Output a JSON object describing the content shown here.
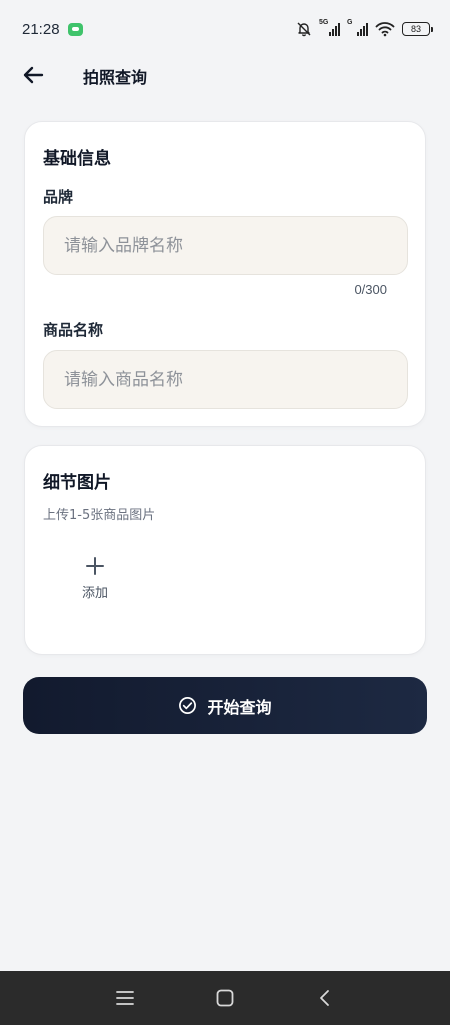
{
  "status_bar": {
    "time": "21:28",
    "sig1_tag": "5G",
    "sig2_tag": "G",
    "battery": "83",
    "icons": [
      "app-notification-icon",
      "bell-muted-icon",
      "signal-icon",
      "wifi-icon",
      "battery-icon"
    ]
  },
  "header": {
    "title": "拍照查询",
    "back_icon": "arrow-left-icon"
  },
  "basic_info": {
    "title": "基础信息",
    "brand": {
      "label": "品牌",
      "value": "",
      "placeholder": "请输入品牌名称",
      "counter": "0/300"
    },
    "product_name": {
      "label": "商品名称",
      "value": "",
      "placeholder": "请输入商品名称"
    }
  },
  "detail_images": {
    "title": "细节图片",
    "subtitle": "上传1-5张商品图片",
    "add_label": "添加",
    "add_icon": "plus-icon"
  },
  "start_button": {
    "label": "开始查询",
    "icon": "check-circle-icon"
  },
  "nav_bar": {
    "icons": [
      "menu-icon",
      "home-square-icon",
      "back-chevron-icon"
    ]
  },
  "colors": {
    "background": "#f3f4f6",
    "card": "#ffffff",
    "input_bg": "#f7f4ef",
    "button_start": "#121a2e",
    "button_end": "#1d2942",
    "nav_bar": "#2b2b2b"
  }
}
